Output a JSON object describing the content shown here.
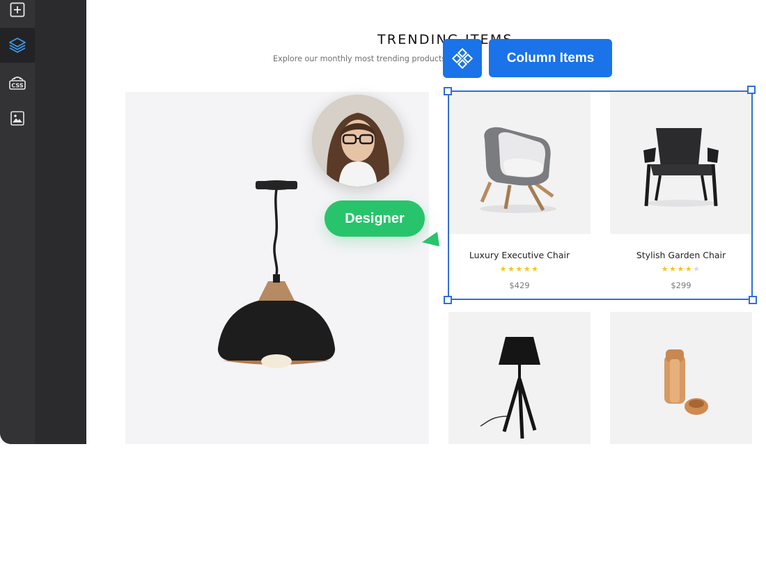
{
  "sidebar": {
    "items": [
      {
        "icon": "plus-square-icon",
        "active": false
      },
      {
        "icon": "layers-icon",
        "active": true
      },
      {
        "icon": "css-icon",
        "label": "CSS",
        "active": false
      },
      {
        "icon": "image-icon",
        "active": false
      }
    ]
  },
  "section": {
    "title": "TRENDING ITEMS",
    "subtitle": "Explore our monthly most trending products, new"
  },
  "products": [
    {
      "name": "Luxury Executive Chair",
      "rating": 5,
      "max_rating": 5,
      "price": "$429"
    },
    {
      "name": "Stylish Garden Chair",
      "rating": 4,
      "max_rating": 5,
      "price": "$299"
    }
  ],
  "selection": {
    "label": "Column Items",
    "icon": "column-items-icon",
    "color": "#1a73e8"
  },
  "collaborator": {
    "label": "Designer",
    "color": "#27c46b"
  },
  "colors": {
    "sidebar": "#2b2b2d",
    "rail": "#333335",
    "selection_border": "#2f6fd6",
    "star": "#f5c518"
  }
}
